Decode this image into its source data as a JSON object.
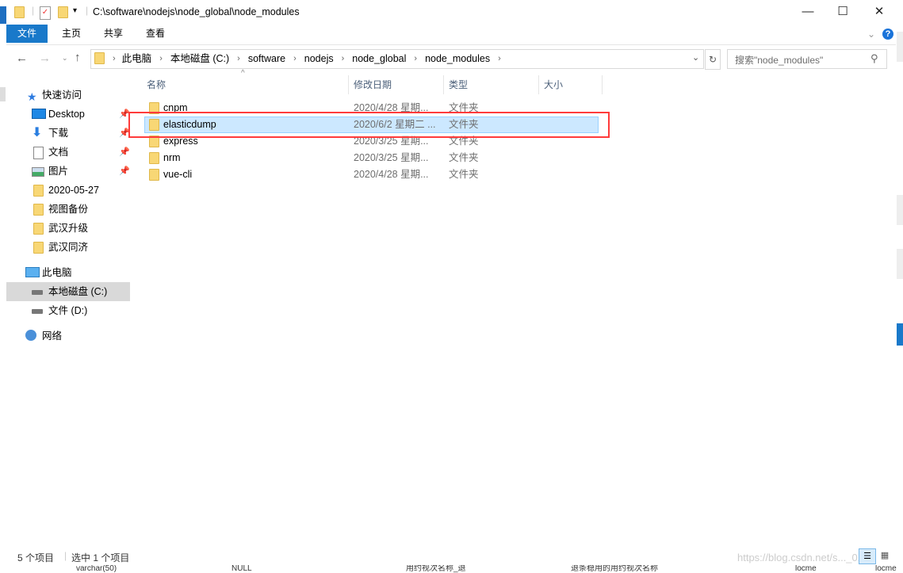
{
  "window": {
    "title": "C:\\software\\nodejs\\node_global\\node_modules",
    "minimize": "—",
    "maximize": "☐",
    "close": "✕"
  },
  "ribbon": {
    "tabs": [
      "文件",
      "主页",
      "共享",
      "查看"
    ],
    "help": "?",
    "expand": "⌄"
  },
  "address": {
    "crumbs": [
      "此电脑",
      "本地磁盘 (C:)",
      "software",
      "nodejs",
      "node_global",
      "node_modules"
    ],
    "search_placeholder": "搜索\"node_modules\""
  },
  "nav": {
    "items": [
      {
        "label": "快速访问",
        "pinned": false
      },
      {
        "label": "Desktop",
        "pinned": true
      },
      {
        "label": "下载",
        "pinned": true
      },
      {
        "label": "文档",
        "pinned": true
      },
      {
        "label": "图片",
        "pinned": true
      },
      {
        "label": "2020-05-27"
      },
      {
        "label": "视图备份"
      },
      {
        "label": "武汉升级"
      },
      {
        "label": "武汉同济"
      },
      {
        "label": "此电脑"
      },
      {
        "label": "本地磁盘 (C:)",
        "selected": true
      },
      {
        "label": "文件 (D:)"
      },
      {
        "label": "网络"
      }
    ]
  },
  "columns": [
    "名称",
    "修改日期",
    "类型",
    "大小"
  ],
  "files": [
    {
      "name": "cnpm",
      "date": "2020/4/28 星期...",
      "type": "文件夹"
    },
    {
      "name": "elasticdump",
      "date": "2020/6/2 星期二 ...",
      "type": "文件夹",
      "selected": true
    },
    {
      "name": "express",
      "date": "2020/3/25 星期...",
      "type": "文件夹"
    },
    {
      "name": "nrm",
      "date": "2020/3/25 星期...",
      "type": "文件夹"
    },
    {
      "name": "vue-cli",
      "date": "2020/4/28 星期...",
      "type": "文件夹"
    }
  ],
  "status": {
    "count": "5 个项目",
    "selected": "选中 1 个项目"
  },
  "highlight_color": "#ff3b3b",
  "watermark": "https://blog.csdn.net/s..._01",
  "background": {
    "cells": [
      "varchar(50)",
      "NULL",
      "用约视次名称_退",
      "退条稳用的用约视次名称",
      "locme",
      "locme"
    ]
  }
}
